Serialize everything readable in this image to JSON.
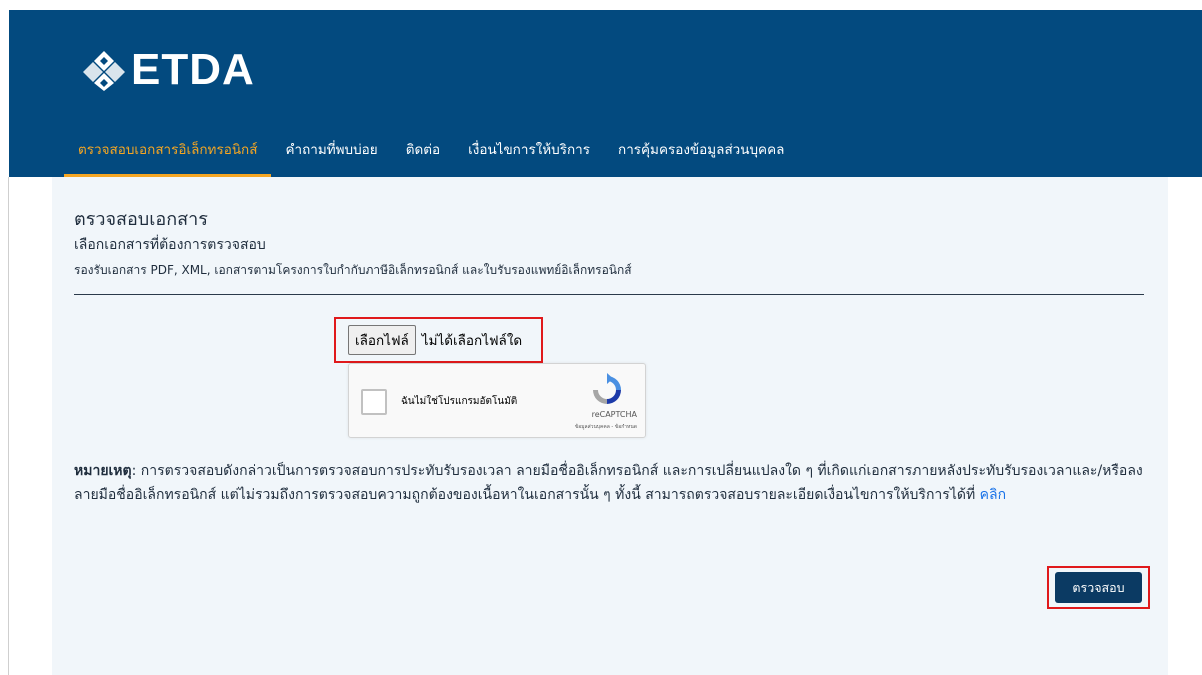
{
  "logo": {
    "text": "ETDA"
  },
  "nav": {
    "items": [
      {
        "label": "ตรวจสอบเอกสารอิเล็กทรอนิกส์",
        "active": true
      },
      {
        "label": "คำถามที่พบบ่อย",
        "active": false
      },
      {
        "label": "ติดต่อ",
        "active": false
      },
      {
        "label": "เงื่อนไขการให้บริการ",
        "active": false
      },
      {
        "label": "การคุ้มครองข้อมูลส่วนบุคคล",
        "active": false
      }
    ]
  },
  "main": {
    "title": "ตรวจสอบเอกสาร",
    "subtitle": "เลือกเอกสารที่ต้องการตรวจสอบ",
    "support_text": "รองรับเอกสาร PDF, XML, เอกสารตามโครงการใบกำกับภาษีอิเล็กทรอนิกส์ และใบรับรองแพทย์อิเล็กทรอนิกส์"
  },
  "file_input": {
    "button_label": "เลือกไฟล์",
    "status": "ไม่ได้เลือกไฟล์ใด"
  },
  "captcha": {
    "label": "ฉันไม่ใช่โปรแกรมอัตโนมัติ",
    "brand": "reCAPTCHA",
    "links": "ข้อมูลส่วนบุคคล - ข้อกำหนด"
  },
  "note": {
    "prefix": "หมายเหตุ",
    "text": ": การตรวจสอบดังกล่าวเป็นการตรวจสอบการประทับรับรองเวลา ลายมือชื่ออิเล็กทรอนิกส์ และการเปลี่ยนแปลงใด ๆ ที่เกิดแก่เอกสารภายหลังประทับรับรองเวลาและ/หรือลงลายมือชื่ออิเล็กทรอนิกส์ แต่ไม่รวมถึงการตรวจสอบความถูกต้องของเนื้อหาในเอกสารนั้น ๆ ทั้งนี้ สามารถตรวจสอบรายละเอียดเงื่อนไขการให้บริการได้ที่ ",
    "link": "คลิก"
  },
  "submit": {
    "label": "ตรวจสอบ"
  },
  "colors": {
    "header_bg": "#034a7f",
    "nav_active": "#f5a623",
    "panel_bg": "#f1f6fa",
    "button_bg": "#0b3a63",
    "highlight": "#e0191b",
    "link": "#1a73e8"
  }
}
